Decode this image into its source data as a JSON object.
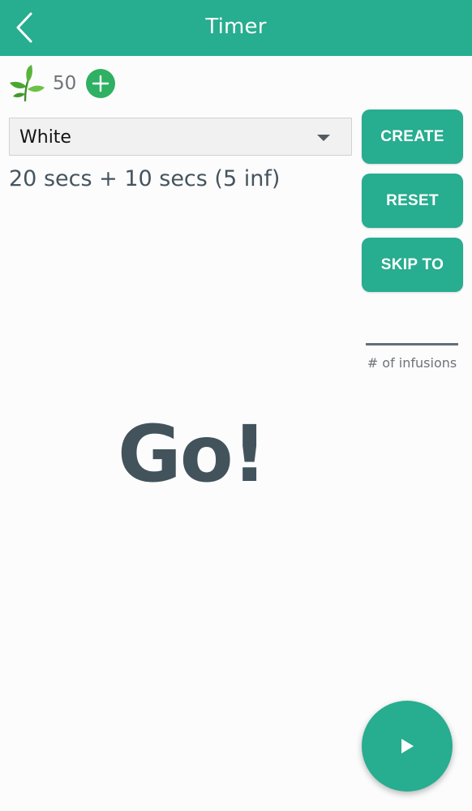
{
  "header": {
    "title": "Timer",
    "back_icon": "chevron-left-icon",
    "background_color": "#27ad8f"
  },
  "leaf_counter": {
    "icon": "tea-leaf-icon",
    "count": "50",
    "add_icon": "plus-circle-icon",
    "add_color": "#2fb062"
  },
  "tea_type": {
    "selected": "White"
  },
  "schedule": {
    "text": "20 secs + 10 secs (5 inf)"
  },
  "actions": {
    "create_label": "CREATE",
    "reset_label": "RESET",
    "skip_to_label": "SKIP TO",
    "color": "#27ad8f"
  },
  "infusions": {
    "label": "# of infusions",
    "value": ""
  },
  "status": {
    "text": "Go!"
  },
  "fab": {
    "icon": "play-icon"
  }
}
